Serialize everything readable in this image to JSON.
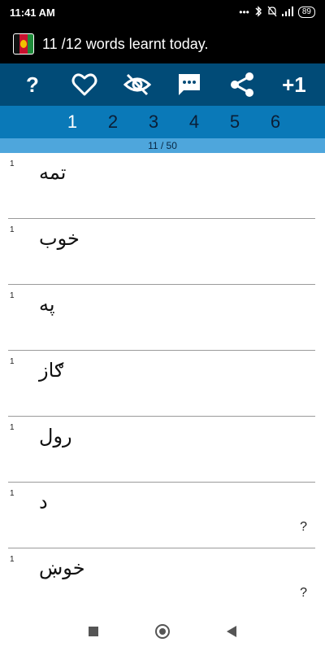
{
  "status": {
    "time": "11:41 AM",
    "battery": "89"
  },
  "appbar": {
    "title": "11 /12 words learnt today."
  },
  "toolbar": {
    "help_label": "?",
    "plus_label": "+1"
  },
  "tabs": [
    "1",
    "2",
    "3",
    "4",
    "5",
    "6"
  ],
  "active_tab": "1",
  "progress": {
    "text": "11 / 50"
  },
  "words": [
    {
      "num": "1",
      "word": "تمه",
      "mark": ""
    },
    {
      "num": "1",
      "word": "خوب",
      "mark": ""
    },
    {
      "num": "1",
      "word": "په",
      "mark": ""
    },
    {
      "num": "1",
      "word": "ګاز",
      "mark": ""
    },
    {
      "num": "1",
      "word": "رول",
      "mark": ""
    },
    {
      "num": "1",
      "word": "د",
      "mark": "?"
    },
    {
      "num": "1",
      "word": "خوښ",
      "mark": "?"
    }
  ],
  "icons": {
    "statusbar": [
      "dots-icon",
      "bluetooth-icon",
      "alarm-off-icon",
      "signal-icon",
      "battery-icon"
    ],
    "toolbar": [
      "question-icon",
      "heart-icon",
      "eye-off-icon",
      "message-icon",
      "share-icon",
      "plus-one-icon"
    ],
    "navbar": [
      "recents-icon",
      "home-icon",
      "back-icon"
    ]
  },
  "colors": {
    "toolbar_bg": "#014b77",
    "tabs_bg": "#0a79b8",
    "progress_bg": "#4ea6dc"
  }
}
